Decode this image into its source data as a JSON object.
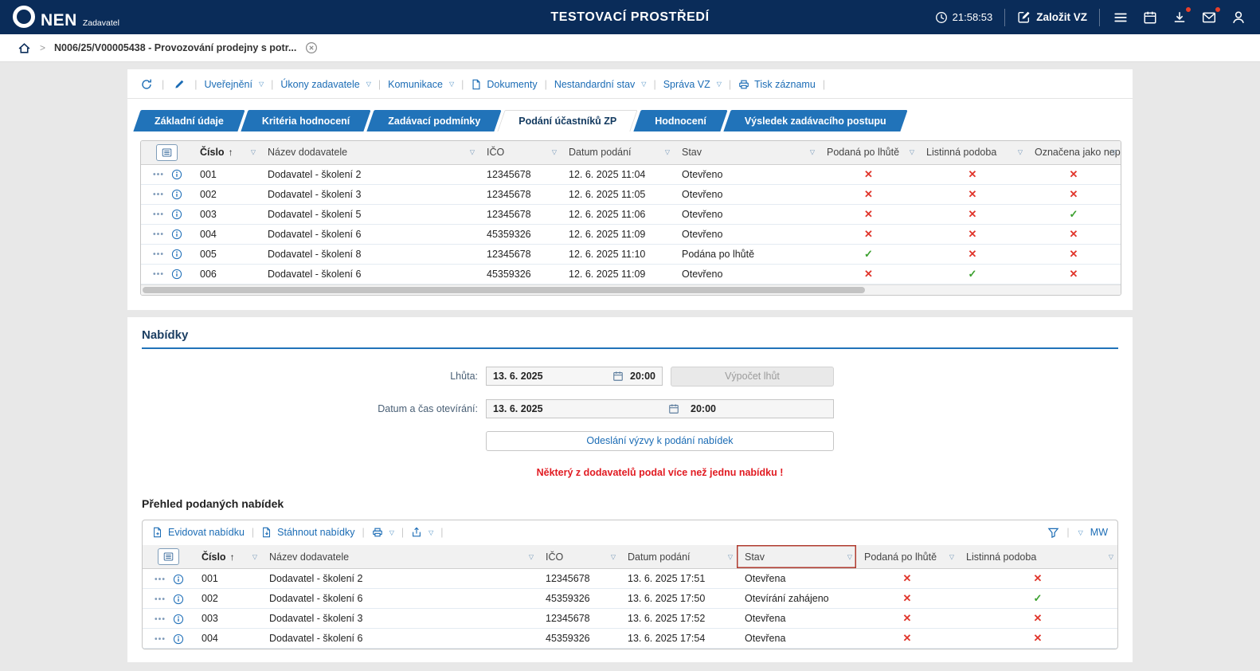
{
  "header": {
    "brand": "NEN",
    "brand_sub": "Zadavatel",
    "env_title": "TESTOVACÍ PROSTŘEDÍ",
    "time": "21:58:53",
    "create_button": "Založit VZ"
  },
  "breadcrumb": {
    "record": "N006/25/V00005438 - Provozování prodejny s potr..."
  },
  "record_toolbar": {
    "items": [
      {
        "label": "Uveřejnění",
        "chevron": true
      },
      {
        "label": "Úkony zadavatele",
        "chevron": true
      },
      {
        "label": "Komunikace",
        "chevron": true
      },
      {
        "label": "Dokumenty",
        "chevron": false,
        "icon": "document"
      },
      {
        "label": "Nestandardní stav",
        "chevron": true
      },
      {
        "label": "Správa VZ",
        "chevron": true
      },
      {
        "label": "Tisk záznamu",
        "chevron": false,
        "icon": "printer"
      }
    ]
  },
  "tabs": [
    {
      "label": "Základní údaje",
      "active": false
    },
    {
      "label": "Kritéria hodnocení",
      "active": false
    },
    {
      "label": "Zadávací podmínky",
      "active": false
    },
    {
      "label": "Podání účastníků ZP",
      "active": true
    },
    {
      "label": "Hodnocení",
      "active": false
    },
    {
      "label": "Výsledek zadávacího postupu",
      "active": false
    }
  ],
  "participations_table": {
    "columns": [
      "Číslo",
      "Název dodavatele",
      "IČO",
      "Datum podání",
      "Stav",
      "Podaná po lhůtě",
      "Listinná podoba",
      "Označena jako nep"
    ],
    "rows": [
      {
        "number": "001",
        "supplier": "Dodavatel - školení 2",
        "ico": "12345678",
        "submitted": "12. 6. 2025 11:04",
        "status": "Otevřeno",
        "late": false,
        "paper": false,
        "flagged": false
      },
      {
        "number": "002",
        "supplier": "Dodavatel - školení 3",
        "ico": "12345678",
        "submitted": "12. 6. 2025 11:05",
        "status": "Otevřeno",
        "late": false,
        "paper": false,
        "flagged": false
      },
      {
        "number": "003",
        "supplier": "Dodavatel - školení 5",
        "ico": "12345678",
        "submitted": "12. 6. 2025 11:06",
        "status": "Otevřeno",
        "late": false,
        "paper": false,
        "flagged": true
      },
      {
        "number": "004",
        "supplier": "Dodavatel - školení 6",
        "ico": "45359326",
        "submitted": "12. 6. 2025 11:09",
        "status": "Otevřeno",
        "late": false,
        "paper": false,
        "flagged": false
      },
      {
        "number": "005",
        "supplier": "Dodavatel - školení 8",
        "ico": "12345678",
        "submitted": "12. 6. 2025 11:10",
        "status": "Podána po lhůtě",
        "late": true,
        "paper": false,
        "flagged": false
      },
      {
        "number": "006",
        "supplier": "Dodavatel - školení 6",
        "ico": "45359326",
        "submitted": "12. 6. 2025 11:09",
        "status": "Otevřeno",
        "late": false,
        "paper": true,
        "flagged": false
      }
    ]
  },
  "bids_section": {
    "title": "Nabídky",
    "deadline_label": "Lhůta:",
    "deadline_date": "13. 6. 2025",
    "deadline_time": "20:00",
    "compute_button": "Výpočet lhůt",
    "opening_label": "Datum a čas otevírání:",
    "opening_date": "13. 6. 2025",
    "opening_time": "20:00",
    "send_invite_button": "Odeslání výzvy k podání nabídek",
    "warning": "Některý z dodavatelů podal více než jednu nabídku !"
  },
  "bids_overview": {
    "title": "Přehled podaných nabídek",
    "toolbar": {
      "register_label": "Evidovat nabídku",
      "download_label": "Stáhnout nabídky",
      "mw_label": "MW"
    },
    "columns": [
      "Číslo",
      "Název dodavatele",
      "IČO",
      "Datum podání",
      "Stav",
      "Podaná po lhůtě",
      "Listinná podoba"
    ],
    "rows": [
      {
        "number": "001",
        "supplier": "Dodavatel - školení 2",
        "ico": "12345678",
        "submitted": "13. 6. 2025 17:51",
        "status": "Otevřena",
        "late": false,
        "paper": false
      },
      {
        "number": "002",
        "supplier": "Dodavatel - školení 6",
        "ico": "45359326",
        "submitted": "13. 6. 2025 17:50",
        "status": "Otevírání zahájeno",
        "late": false,
        "paper": true
      },
      {
        "number": "003",
        "supplier": "Dodavatel - školení 3",
        "ico": "12345678",
        "submitted": "13. 6. 2025 17:52",
        "status": "Otevřena",
        "late": false,
        "paper": false
      },
      {
        "number": "004",
        "supplier": "Dodavatel - školení 6",
        "ico": "45359326",
        "submitted": "13. 6. 2025 17:54",
        "status": "Otevřena",
        "late": false,
        "paper": false
      }
    ]
  }
}
